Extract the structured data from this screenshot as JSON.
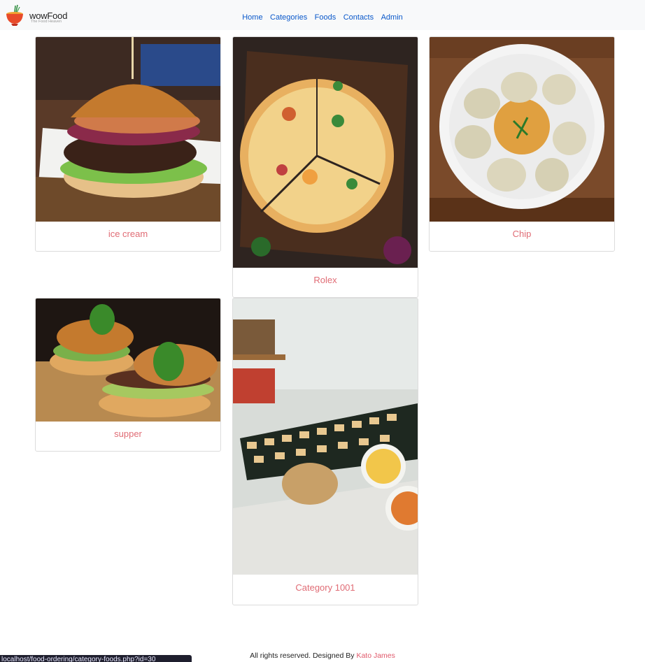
{
  "brand": {
    "name": "wowFood",
    "tagline": "The Food Heaven",
    "icon": "food-bowl-icon"
  },
  "nav": {
    "links": [
      "Home",
      "Categories",
      "Foods",
      "Contacts",
      "Admin"
    ],
    "color": "#0a58ca"
  },
  "cards": [
    {
      "label": "ice cream",
      "image": "burger-photo"
    },
    {
      "label": "Rolex",
      "image": "pizza-photo"
    },
    {
      "label": "Chip",
      "image": "dumplings-photo"
    },
    {
      "label": "supper",
      "image": "burgers-on-board-photo"
    },
    {
      "label": "Category 1001",
      "image": "buffet-table-photo"
    }
  ],
  "footer": {
    "text": "All rights reserved. Designed By",
    "author": "Kato James"
  },
  "status_bar": {
    "url": "localhost/food-ordering/category-foods.php?id=30"
  },
  "colors": {
    "accent": "#e06c75",
    "navbar_bg": "#f8f9fa"
  }
}
